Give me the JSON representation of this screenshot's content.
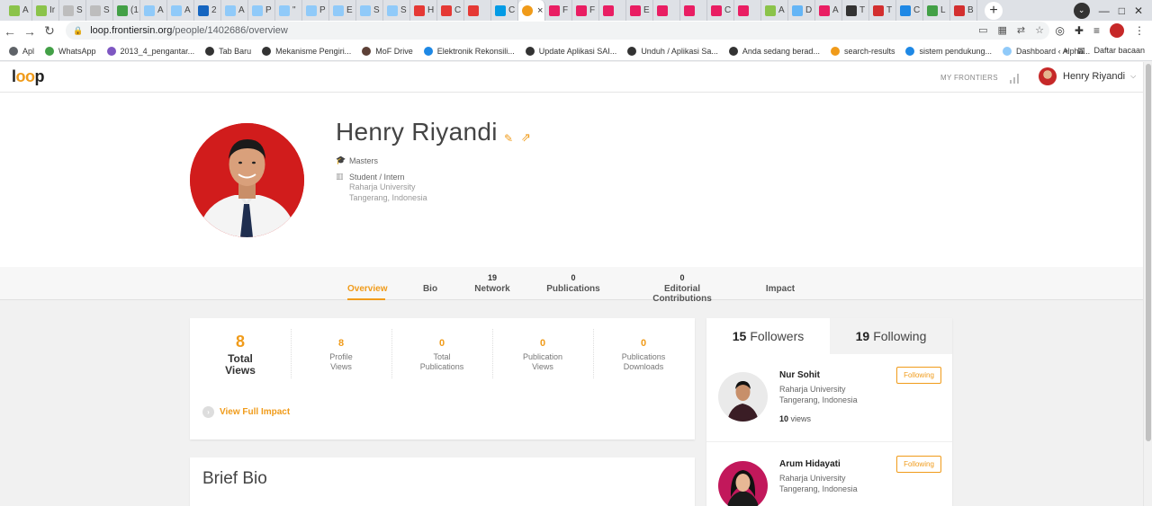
{
  "browser": {
    "tabs": [
      {
        "label": "A",
        "color": "#8bc34a"
      },
      {
        "label": "Ir",
        "color": "#8bc34a"
      },
      {
        "label": "S",
        "color": "#bdbdbd"
      },
      {
        "label": "S",
        "color": "#bdbdbd"
      },
      {
        "label": "(1",
        "color": "#43a047"
      },
      {
        "label": "A",
        "color": "#90caf9"
      },
      {
        "label": "A",
        "color": "#90caf9"
      },
      {
        "label": "2",
        "color": "#1565c0"
      },
      {
        "label": "A",
        "color": "#90caf9"
      },
      {
        "label": "P",
        "color": "#90caf9"
      },
      {
        "label": "\"",
        "color": "#90caf9"
      },
      {
        "label": "P",
        "color": "#90caf9"
      },
      {
        "label": "E",
        "color": "#90caf9"
      },
      {
        "label": "S",
        "color": "#90caf9"
      },
      {
        "label": "S",
        "color": "#90caf9"
      },
      {
        "label": "H",
        "color": "#e53935"
      },
      {
        "label": "C",
        "color": "#e53935"
      },
      {
        "label": "",
        "color": "#e53935"
      },
      {
        "label": "C",
        "color": "#039be5"
      }
    ],
    "active_tab": {
      "close": "×",
      "color": "#f09b1a"
    },
    "tabs_after": [
      {
        "label": "F",
        "color": "#e91e63"
      },
      {
        "label": "F",
        "color": "#e91e63"
      },
      {
        "label": "",
        "color": "#e91e63"
      },
      {
        "label": "E",
        "color": "#e91e63"
      },
      {
        "label": "",
        "color": "#e91e63"
      },
      {
        "label": "",
        "color": "#e91e63"
      },
      {
        "label": "C",
        "color": "#e91e63"
      },
      {
        "label": "",
        "color": "#e91e63"
      },
      {
        "label": "A",
        "color": "#8bc34a"
      },
      {
        "label": "D",
        "color": "#64b5f6"
      },
      {
        "label": "A",
        "color": "#e91e63"
      },
      {
        "label": "T",
        "color": "#333333"
      },
      {
        "label": "T",
        "color": "#d32f2f"
      },
      {
        "label": "C",
        "color": "#1e88e5"
      },
      {
        "label": "L",
        "color": "#43a047"
      },
      {
        "label": "B",
        "color": "#d32f2f"
      }
    ],
    "new_tab": "+",
    "window_controls": [
      "—",
      "□",
      "✕"
    ],
    "url_host": "loop.frontiersin.org",
    "url_path": "/people/1402686/overview",
    "bookmarks": [
      {
        "label": "Apl",
        "color": "#5f6368"
      },
      {
        "label": "WhatsApp",
        "color": "#43a047"
      },
      {
        "label": "2013_4_pengantar...",
        "color": "#7e57c2"
      },
      {
        "label": "Tab Baru",
        "color": "#333333"
      },
      {
        "label": "Mekanisme Pengiri...",
        "color": "#333333"
      },
      {
        "label": "MoF Drive",
        "color": "#5d4037"
      },
      {
        "label": "Elektronik Rekonsili...",
        "color": "#1e88e5"
      },
      {
        "label": "Update Aplikasi SAI...",
        "color": "#333333"
      },
      {
        "label": "Unduh / Aplikasi Sa...",
        "color": "#333333"
      },
      {
        "label": "Anda sedang berad...",
        "color": "#333333"
      },
      {
        "label": "search-results",
        "color": "#f09b1a"
      },
      {
        "label": "sistem pendukung...",
        "color": "#1e88e5"
      },
      {
        "label": "Dashboard ‹ Alpha...",
        "color": "#90caf9"
      }
    ],
    "bookmarks_more": "»",
    "reading_list": "Daftar bacaan"
  },
  "site": {
    "logo_pre": "l",
    "logo_oo": "oo",
    "logo_post": "p",
    "my_frontiers": "MY FRONTIERS",
    "user_name": "Henry Riyandi",
    "caret": "⌵"
  },
  "profile": {
    "name": "Henry Riyandi",
    "degree": "Masters",
    "position": "Student / Intern",
    "institution": "Raharja University",
    "location": "Tangerang, Indonesia"
  },
  "tabs": [
    {
      "label": "Overview",
      "count": "",
      "active": true
    },
    {
      "label": "Bio",
      "count": ""
    },
    {
      "label": "Network",
      "count": "19"
    },
    {
      "label": "Publications",
      "count": "0"
    },
    {
      "label": "Editorial Contributions",
      "count": "0"
    },
    {
      "label": "Impact",
      "count": ""
    }
  ],
  "stats": {
    "total_views": {
      "value": "8",
      "label1": "Total",
      "label2": "Views"
    },
    "items": [
      {
        "value": "8",
        "label1": "Profile",
        "label2": "Views"
      },
      {
        "value": "0",
        "label1": "Total",
        "label2": "Publications"
      },
      {
        "value": "0",
        "label1": "Publication",
        "label2": "Views"
      },
      {
        "value": "0",
        "label1": "Publications",
        "label2": "Downloads"
      }
    ],
    "view_full_impact": "View Full Impact"
  },
  "bio": {
    "title": "Brief Bio"
  },
  "follow": {
    "followers_count": "15",
    "followers_label": "Followers",
    "following_count": "19",
    "following_label": "Following",
    "people": [
      {
        "name": "Nur Sohit",
        "institution": "Raharja University",
        "location": "Tangerang, Indonesia",
        "views": "10",
        "views_label": "views",
        "button": "Following"
      },
      {
        "name": "Arum Hidayati",
        "institution": "Raharja University",
        "location": "Tangerang, Indonesia",
        "views": "",
        "views_label": "",
        "button": "Following"
      }
    ]
  },
  "colors": {
    "accent": "#f09b1a",
    "photo_bg": "#d11c1c"
  }
}
